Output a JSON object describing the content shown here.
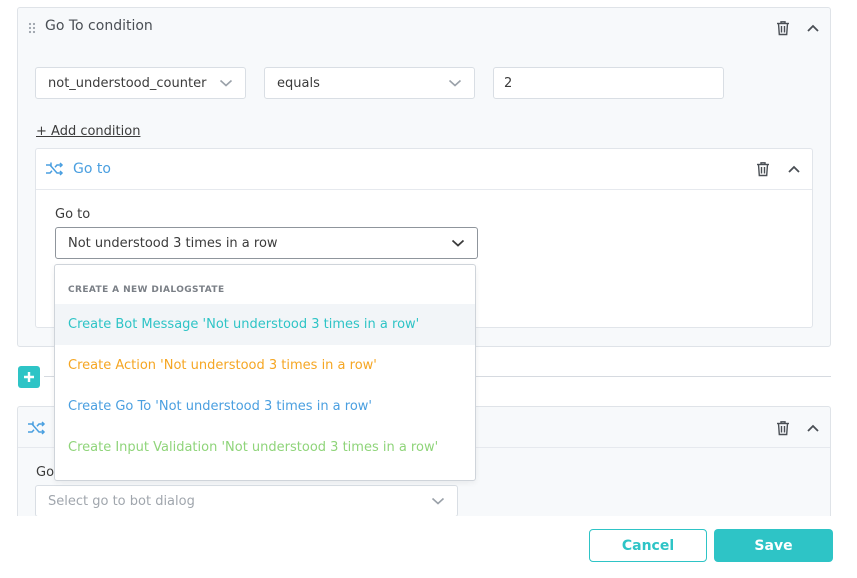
{
  "colors": {
    "teal": "#2ec4c6",
    "orange": "#f5a623",
    "blue": "#4a9fe0",
    "green": "#8fd47a",
    "link_blue": "#4a9fe0"
  },
  "condition_card": {
    "title": "Go To condition",
    "drag_icon": "drag-handle-icon",
    "delete_icon": "trash-icon",
    "collapse_icon": "chevron-up-icon",
    "variable_select": {
      "value": "not_understood_counter"
    },
    "operator_select": {
      "value": "equals"
    },
    "value_input": {
      "value": "2"
    },
    "add_condition_label": "+ Add condition"
  },
  "goto_card": {
    "title": "Go to",
    "icon": "shuffle-icon",
    "field_label": "Go to",
    "select_value": "Not understood 3 times in a row"
  },
  "dropdown": {
    "header": "CREATE A NEW DIALOGSTATE",
    "items": [
      {
        "label": "Create Bot Message 'Not understood 3 times in a row'",
        "color": "#2ec4c6"
      },
      {
        "label": "Create Action 'Not understood 3 times in a row'",
        "color": "#f5a623"
      },
      {
        "label": "Create Go To 'Not understood 3 times in a row'",
        "color": "#4a9fe0"
      },
      {
        "label": "Create Input Validation 'Not understood 3 times in a row'",
        "color": "#8fd47a"
      }
    ]
  },
  "second_card": {
    "field_label": "Go",
    "select_placeholder": "Select go to bot dialog"
  },
  "footer": {
    "cancel_label": "Cancel",
    "save_label": "Save"
  }
}
